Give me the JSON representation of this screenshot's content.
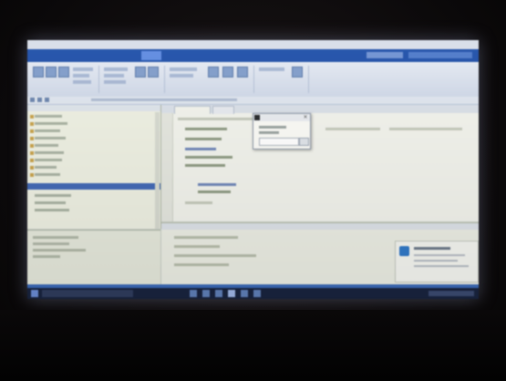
{
  "window": {
    "title": ""
  },
  "ribbon": {
    "tabs": [
      {
        "label": "",
        "active": false
      },
      {
        "label": "",
        "active": false
      },
      {
        "label": "",
        "active": false
      },
      {
        "label": "",
        "active": true
      },
      {
        "label": "",
        "active": false
      },
      {
        "label": "",
        "active": false
      }
    ],
    "search_placeholder": ""
  },
  "solution_explorer": {
    "title": ""
  },
  "editor": {
    "active_tab": "",
    "second_tab": ""
  },
  "dialog": {
    "title": "",
    "field_value": ""
  },
  "notification": {
    "title": ""
  },
  "taskbar": {
    "search_placeholder": ""
  },
  "colors": {
    "ribbon_tab_bar": "#1d4ea8",
    "selection": "#3f66b4",
    "status_bar": "#3a68b6",
    "taskbar": "#18233e"
  }
}
